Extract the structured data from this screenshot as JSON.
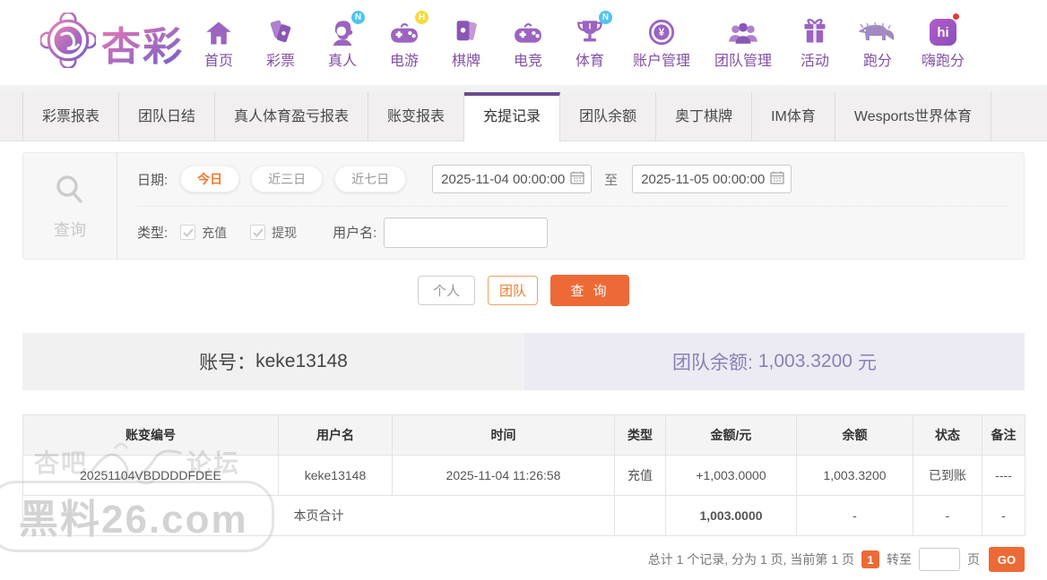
{
  "header": {
    "logo_text": "杏彩",
    "nav": [
      {
        "label": "首页",
        "icon": "home-icon",
        "badge": ""
      },
      {
        "label": "彩票",
        "icon": "lottery-icon",
        "badge": ""
      },
      {
        "label": "真人",
        "icon": "live-person-icon",
        "badge": "N"
      },
      {
        "label": "电游",
        "icon": "slots-icon",
        "badge": "H"
      },
      {
        "label": "棋牌",
        "icon": "cards-icon",
        "badge": ""
      },
      {
        "label": "电竞",
        "icon": "esports-icon",
        "badge": ""
      },
      {
        "label": "体育",
        "icon": "trophy-icon",
        "badge": "N"
      },
      {
        "label": "账户管理",
        "icon": "account-coin-icon",
        "badge": ""
      },
      {
        "label": "团队管理",
        "icon": "team-icon",
        "badge": ""
      },
      {
        "label": "活动",
        "icon": "gift-icon",
        "badge": ""
      },
      {
        "label": "跑分",
        "icon": "rhino-icon",
        "badge": ""
      },
      {
        "label": "嗨跑分",
        "icon": "hi-app-icon",
        "badge": "dot",
        "app_text": "hi"
      }
    ]
  },
  "tabs": {
    "items": [
      {
        "label": "彩票报表",
        "active": false
      },
      {
        "label": "团队日结",
        "active": false
      },
      {
        "label": "真人体育盈亏报表",
        "active": false
      },
      {
        "label": "账变报表",
        "active": false
      },
      {
        "label": "充提记录",
        "active": true
      },
      {
        "label": "团队余额",
        "active": false
      },
      {
        "label": "奥丁棋牌",
        "active": false
      },
      {
        "label": "IM体育",
        "active": false
      },
      {
        "label": "Wesports世界体育",
        "active": false
      }
    ]
  },
  "filter": {
    "side_label": "查询",
    "date_label": "日期:",
    "presets": [
      {
        "label": "今日",
        "active": true
      },
      {
        "label": "近三日",
        "active": false
      },
      {
        "label": "近七日",
        "active": false
      }
    ],
    "date_from": "2025-11-04 00:00:00",
    "to_label": "至",
    "date_to": "2025-11-05 00:00:00",
    "type_label": "类型:",
    "types": [
      {
        "label": "充值",
        "checked": true
      },
      {
        "label": "提现",
        "checked": true
      }
    ],
    "username_label": "用户名:",
    "username_value": ""
  },
  "actions": {
    "personal_label": "个人",
    "team_label": "团队",
    "search_label": "查 询"
  },
  "account_bar": {
    "account_label": "账号：",
    "account_value": "keke13148",
    "balance_label": "团队余额:",
    "balance_value": "1,003.3200",
    "balance_unit": "元"
  },
  "table": {
    "headers": [
      "账变编号",
      "用户名",
      "时间",
      "类型",
      "金额/元",
      "余额",
      "状态",
      "备注"
    ],
    "rows": [
      {
        "id": "20251104VBDDDDFDEE",
        "username": "keke13148",
        "time": "2025-11-04 11:26:58",
        "type": "充值",
        "amount": "+1,003.0000",
        "balance": "1,003.3200",
        "status": "已到账",
        "remark": "----"
      }
    ],
    "total_row": {
      "label": "本页合计",
      "amount": "1,003.0000",
      "balance": "-",
      "status": "-",
      "remark": "-"
    }
  },
  "pagination": {
    "summary": "总计 1 个记录, 分为 1 页, 当前第 1 页",
    "current_page": "1",
    "goto_label": "转至",
    "page_unit": "页",
    "go_label": "GO"
  },
  "watermarks": {
    "forum_left": "杏吧",
    "forum_right": "论坛",
    "site": "黑料26.com"
  },
  "colors": {
    "accent_orange": "#ed6a36",
    "brand_purple": "#8250a5",
    "tab_active_purple": "#6a4b8f",
    "amount_green": "#9cba3e",
    "status_green": "#55a555",
    "balance_purple": "#8b80b7",
    "badge_cyan": "#4fc3f0",
    "badge_yellow": "#f2dc3f"
  }
}
